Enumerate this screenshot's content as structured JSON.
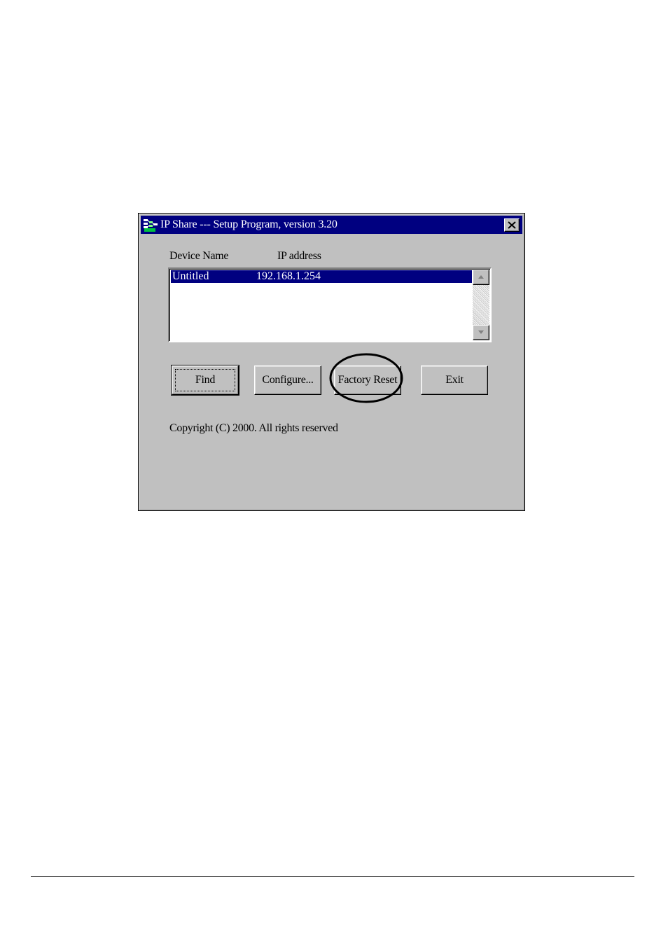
{
  "window": {
    "title": "IP Share --- Setup Program, version 3.20",
    "title_icon": "network-app-icon",
    "close_icon": "close-icon"
  },
  "device_list": {
    "columns": [
      "Device Name",
      "IP address"
    ],
    "rows": [
      {
        "device_name": "Untitled",
        "ip_address": "192.168.1.254",
        "selected": true
      }
    ]
  },
  "buttons": {
    "find": "Find",
    "configure": "Configure...",
    "factory_reset": "Factory Reset",
    "exit": "Exit"
  },
  "copyright": "Copyright (C) 2000.  All rights reserved",
  "colors": {
    "titlebar": "#000080",
    "dialog_face": "#c0c0c0",
    "selection": "#000080"
  }
}
